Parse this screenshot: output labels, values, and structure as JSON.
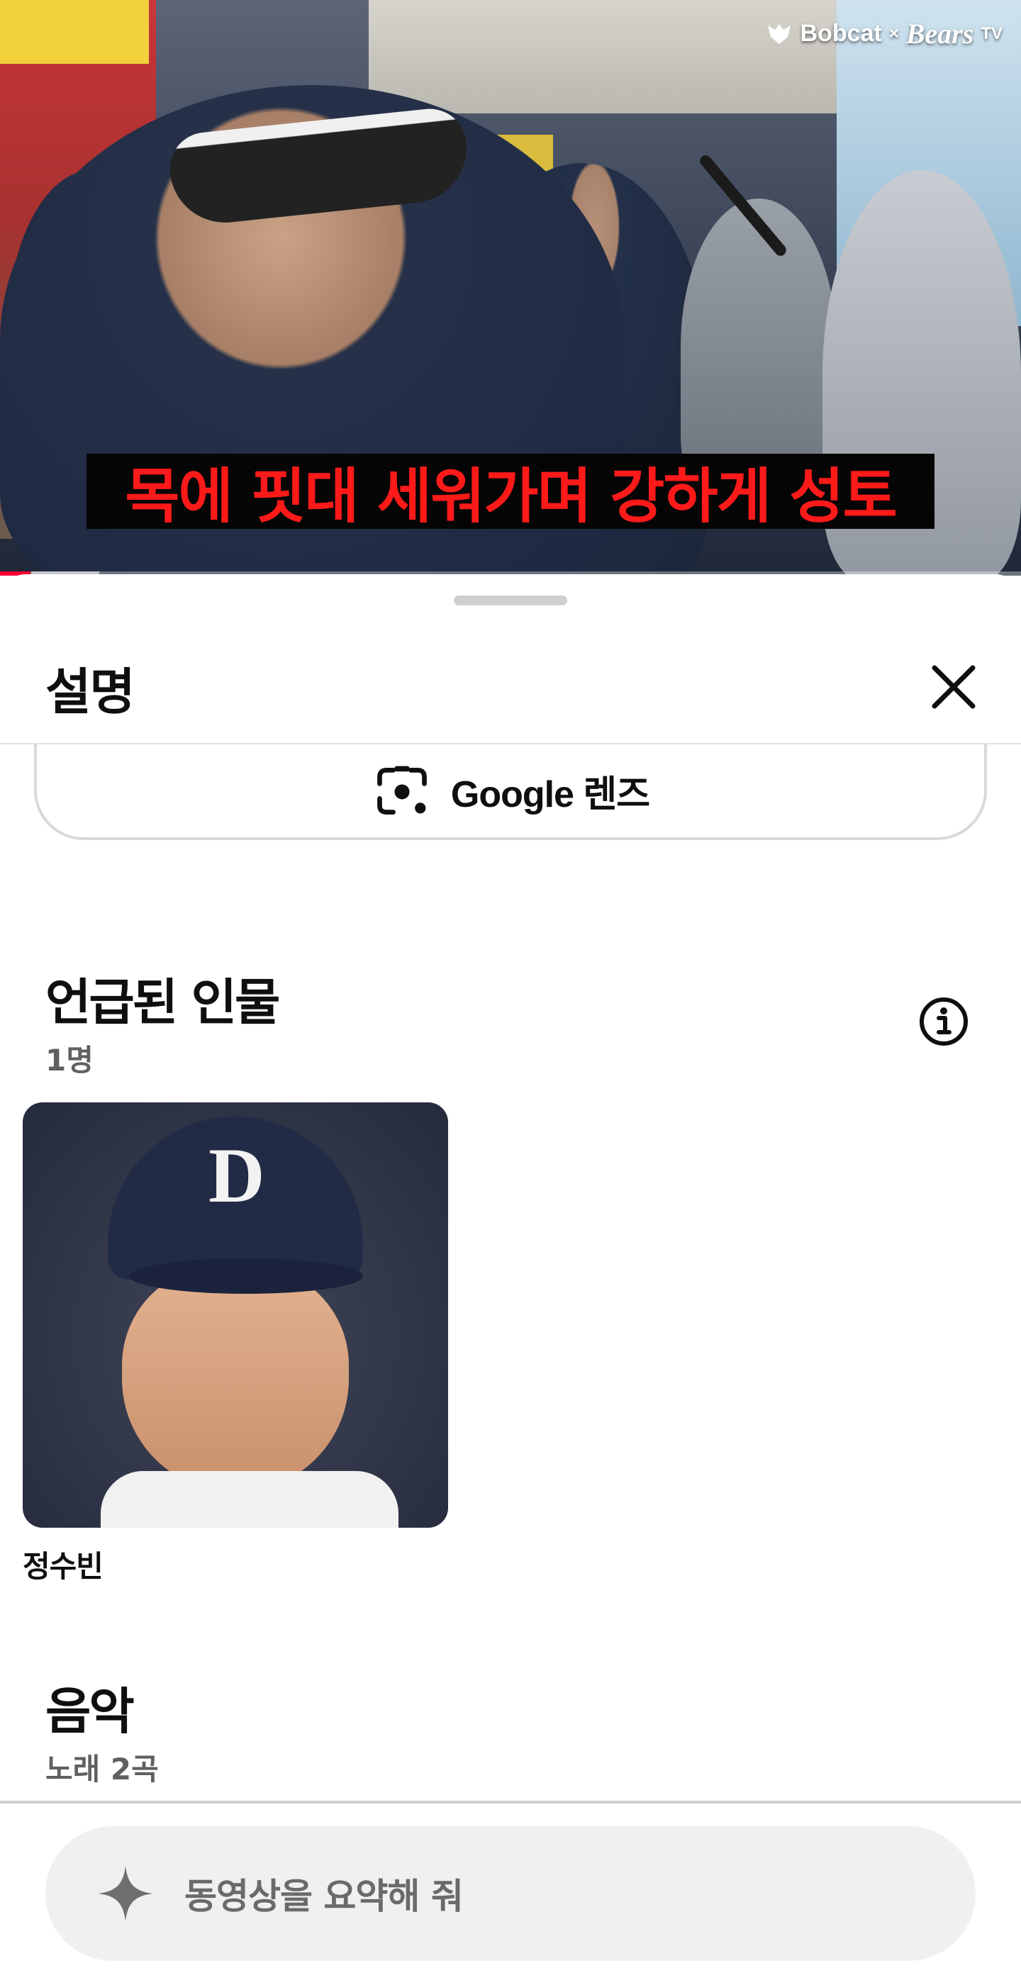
{
  "video": {
    "brand_left": "Bobcat",
    "brand_x": "×",
    "brand_right": "Bears",
    "brand_tv": "TV",
    "caption": "목에 핏대 세워가며 강하게 성토",
    "progress_fraction": 0.03
  },
  "sheet": {
    "title": "설명",
    "close_icon": "close-icon",
    "lens_label": "Google 렌즈",
    "people": {
      "title": "언급된 인물",
      "count": "1명",
      "info_icon": "info-icon",
      "items": [
        {
          "name": "정수빈"
        }
      ]
    },
    "music": {
      "title": "음악",
      "count": "노래 2곡"
    },
    "ask": {
      "placeholder": "동영상을 요약해 줘",
      "icon": "sparkle-icon"
    }
  },
  "colors": {
    "caption_text": "#ff1a1a",
    "progress": "#ff0033",
    "muted_text": "#606060"
  }
}
